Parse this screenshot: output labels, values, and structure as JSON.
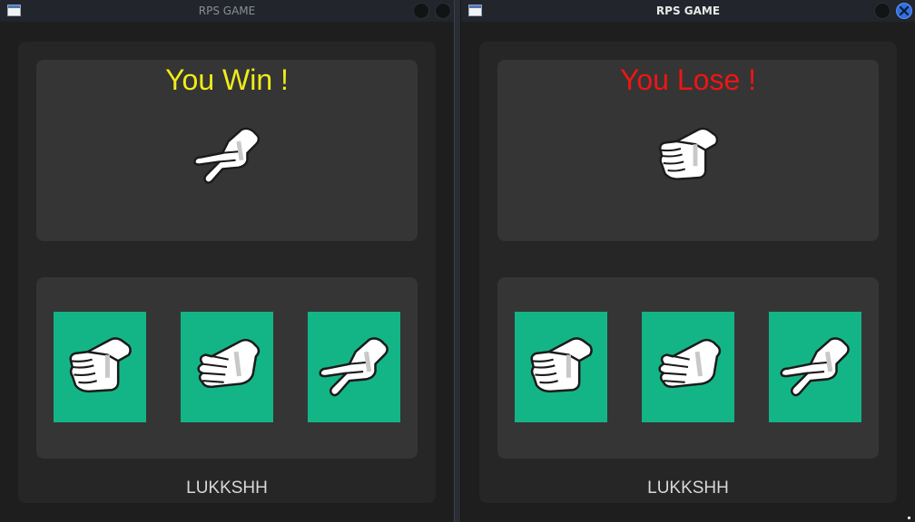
{
  "windows": [
    {
      "title": "RPS GAME",
      "result": "You Win !",
      "result_color": "#f0ec18",
      "computer_choice": "scissors-hand-icon",
      "choices": [
        {
          "icon": "rock-hand-icon"
        },
        {
          "icon": "paper-hand-icon"
        },
        {
          "icon": "scissors-hand-icon"
        }
      ],
      "footer": "LUKKSHH"
    },
    {
      "title": "RPS GAME",
      "result": "You Lose !",
      "result_color": "#f01414",
      "computer_choice": "rock-hand-icon",
      "choices": [
        {
          "icon": "rock-hand-icon"
        },
        {
          "icon": "paper-hand-icon"
        },
        {
          "icon": "scissors-hand-icon"
        }
      ],
      "footer": "LUKKSHH"
    }
  ],
  "colors": {
    "choice_bg": "#13b586",
    "panel": "#353535",
    "window": "#1e1e1e"
  }
}
